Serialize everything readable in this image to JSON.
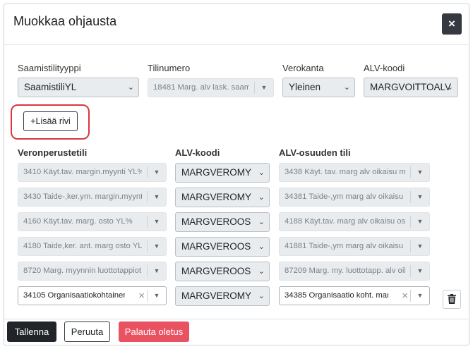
{
  "header": {
    "title": "Muokkaa ohjausta",
    "close_label": "×"
  },
  "top_row": {
    "labels": [
      "Saamistilityyppi",
      "Tilinumero",
      "Verokanta",
      "ALV-koodi"
    ],
    "saamistilityyppi": "SaamistiliYL",
    "tilinumero": "18481 Marg. alv lask. saam...",
    "verokanta": "Yleinen",
    "alv_koodi": "MARGVOITTOALV"
  },
  "add_row_label": "+Lisää rivi",
  "table": {
    "headers": [
      "Veronperustetili",
      "ALV-koodi",
      "ALV-osuuden tili"
    ],
    "rows": [
      {
        "base": "3410 Käyt.tav. margin.myynti YL%",
        "code": "MARGVEROMY",
        "share": "3438 Käyt. tav. marg alv oikaisu my..."
      },
      {
        "base": "3430 Taide-,ker.ym. margin.myynt...",
        "code": "MARGVEROMY",
        "share": "34381 Taide-,ym marg alv oikaisu ..."
      },
      {
        "base": "4160 Käyt.tav. marg. osto YL%",
        "code": "MARGVEROOS",
        "share": "4188 Käyt.tav. marg alv oikaisu ost ..."
      },
      {
        "base": "4180 Taide,ker. ant. marg osto YL%",
        "code": "MARGVEROOS",
        "share": "41881 Taide-,ym marg alv oikaisu o..."
      },
      {
        "base": "8720 Marg. myynnin luottotappiot...",
        "code": "MARGVEROOS",
        "share": "87209 Marg. my. luottotapp. alv oik..."
      },
      {
        "base": "34105 Organisaatiokohtainen ...",
        "code": "MARGVEROMY",
        "share": "34385 Organisaatio koht. marg ..."
      }
    ]
  },
  "footer": {
    "save": "Tallenna",
    "cancel": "Peruuta",
    "reset": "Palauta oletus"
  },
  "icons": {
    "close": "close-icon",
    "dropdown": "chevron-down-icon",
    "clear": "clear-icon",
    "delete": "trash-icon"
  },
  "colors": {
    "primary_dark": "#212529",
    "danger": "#e95361",
    "highlight": "#d9363e"
  }
}
